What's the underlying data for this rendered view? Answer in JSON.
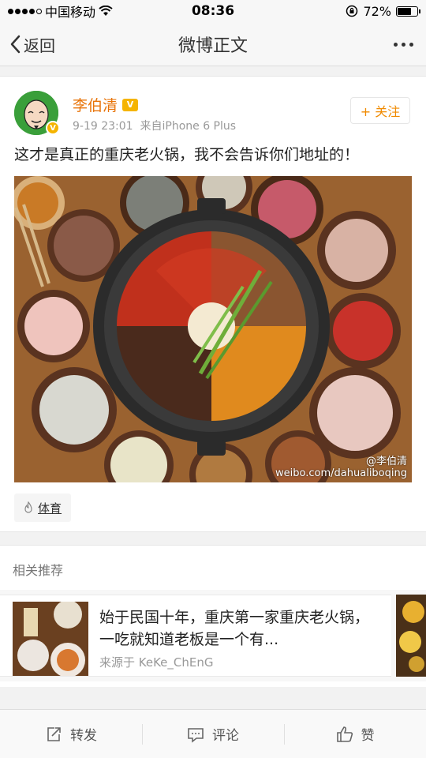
{
  "status": {
    "carrier": "中国移动",
    "time": "08:36",
    "battery_percent": "72%",
    "battery_level": 0.72
  },
  "nav": {
    "back_label": "返回",
    "title": "微博正文"
  },
  "post": {
    "author": "李伯清",
    "date": "9-19 23:01",
    "source": "来自iPhone 6 Plus",
    "follow_label": "+ 关注",
    "text": "这才是真正的重庆老火锅，我不会告诉你们地址的！",
    "watermark_user": "@李伯清",
    "watermark_url": "weibo.com/dahualiboqing",
    "topic": "体育"
  },
  "related": {
    "title": "相关推荐",
    "headline": "始于民国十年，重庆第一家重庆老火锅，一吃就知道老板是一个有...",
    "source": "来源于 KeKe_ChEnG"
  },
  "actions": {
    "repost": "转发",
    "comment": "评论",
    "like": "赞"
  },
  "colors": {
    "accent_orange": "#e8740a",
    "follow_orange": "#f08a00"
  }
}
